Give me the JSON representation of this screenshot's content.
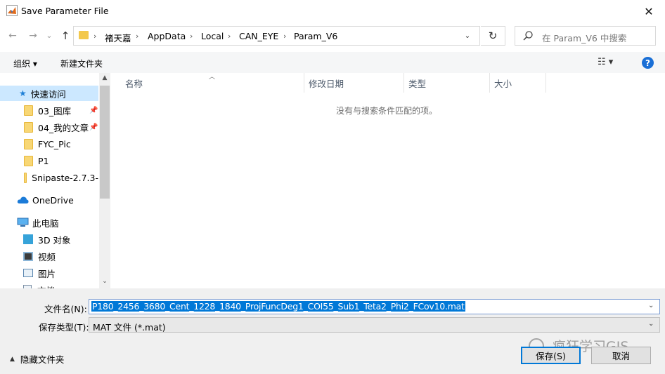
{
  "window": {
    "title": "Save Parameter File",
    "close_glyph": "✕"
  },
  "nav": {
    "back": "←",
    "forward": "→",
    "recent": "⌄",
    "up": "↑"
  },
  "address": {
    "crumbs": [
      "褚天嘉",
      "AppData",
      "Local",
      "CAN_EYE",
      "Param_V6"
    ],
    "separator": "›",
    "dropdown": "⌄",
    "refresh_glyph": "↻"
  },
  "search": {
    "placeholder": "在 Param_V6 中搜索",
    "icon": "search-icon"
  },
  "toolbar": {
    "organize": "组织 ▾",
    "new_folder": "新建文件夹",
    "view": "☷ ▾",
    "help": "?"
  },
  "sidebar": {
    "quick_access": "快速访问",
    "items": [
      {
        "label": "03_图库",
        "pinned": true
      },
      {
        "label": "04_我的文章",
        "pinned": true
      },
      {
        "label": "FYC_Pic",
        "pinned": false
      },
      {
        "label": "P1",
        "pinned": false
      },
      {
        "label": "Snipaste-2.7.3-",
        "pinned": false
      }
    ],
    "onedrive": "OneDrive",
    "this_pc": "此电脑",
    "pc_items": [
      "3D 对象",
      "视频",
      "图片",
      "文档"
    ],
    "pin_glyph": "📌"
  },
  "columns": [
    "名称",
    "修改日期",
    "类型",
    "大小"
  ],
  "empty_message": "没有与搜索条件匹配的项。",
  "form": {
    "filename_label": "文件名(N):",
    "filename_value": "P180_2456_3680_Cent_1228_1840_ProjFuncDeg1_COI55_Sub1_Teta2_Phi2_FCov10.mat",
    "filetype_label": "保存类型(T):",
    "filetype_value": "MAT 文件 (*.mat)",
    "dropdown_glyph": "⌄"
  },
  "footer": {
    "hide_folders": "隐藏文件夹",
    "save": "保存(S)",
    "cancel": "取消"
  },
  "watermark": "疯狂学习GIS",
  "colors": {
    "accent": "#0078d7",
    "folder": "#f8d775",
    "help": "#1a6fd6"
  }
}
